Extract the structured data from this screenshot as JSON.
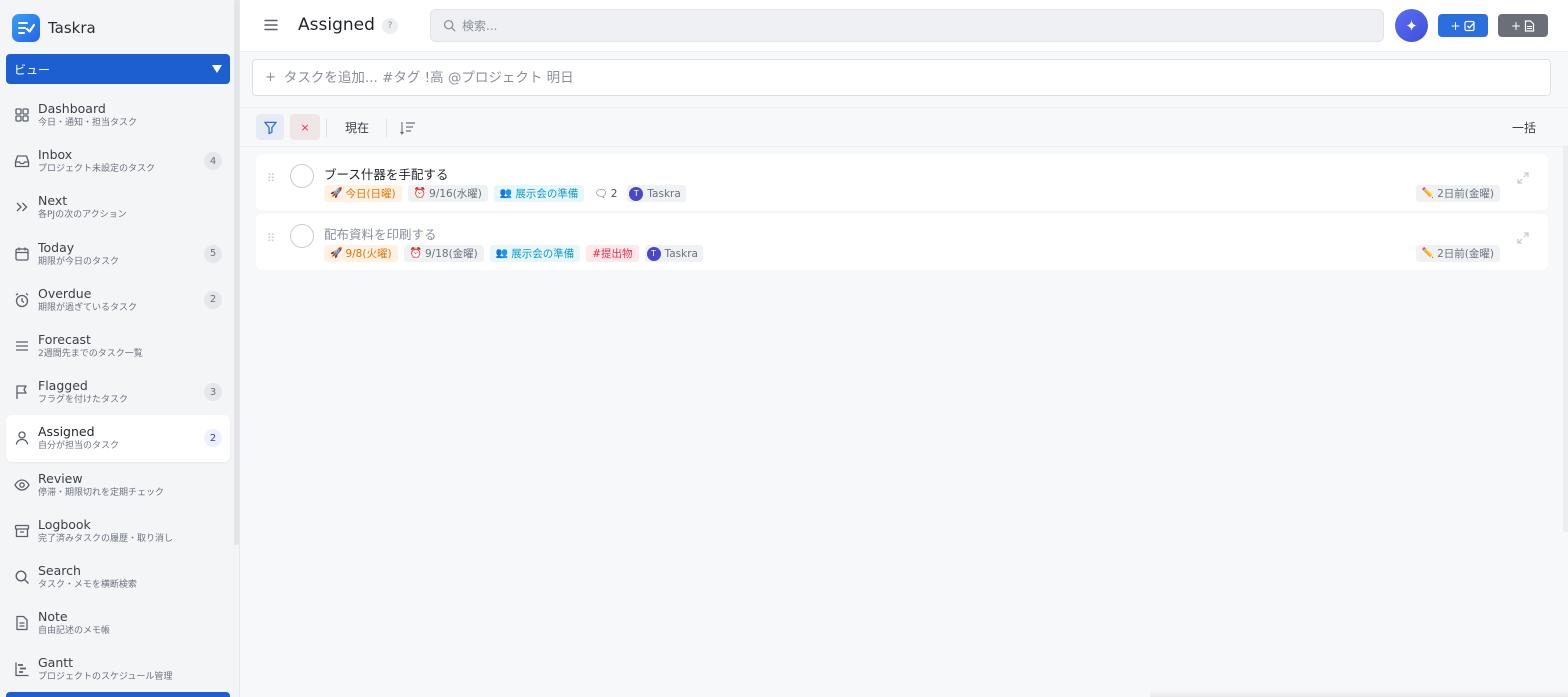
{
  "app": {
    "name": "Taskra"
  },
  "sidebar": {
    "view_select": "ビュー",
    "items": [
      {
        "id": "dashboard",
        "title": "Dashboard",
        "subtitle": "今日・通知・担当タスク",
        "badge": "",
        "icon": "grid-icon"
      },
      {
        "id": "inbox",
        "title": "Inbox",
        "subtitle": "プロジェクト未設定のタスク",
        "badge": "4",
        "icon": "inbox-icon"
      },
      {
        "id": "next",
        "title": "Next",
        "subtitle": "各PJの次のアクション",
        "badge": "",
        "icon": "double-chevron-right-icon"
      },
      {
        "id": "today",
        "title": "Today",
        "subtitle": "期限が今日のタスク",
        "badge": "5",
        "icon": "calendar-icon"
      },
      {
        "id": "overdue",
        "title": "Overdue",
        "subtitle": "期限が過ぎているタスク",
        "badge": "2",
        "icon": "alarm-clock-icon"
      },
      {
        "id": "forecast",
        "title": "Forecast",
        "subtitle": "2週間先までのタスク一覧",
        "badge": "",
        "icon": "lines-icon"
      },
      {
        "id": "flagged",
        "title": "Flagged",
        "subtitle": "フラグを付けたタスク",
        "badge": "3",
        "icon": "flag-icon"
      },
      {
        "id": "assigned",
        "title": "Assigned",
        "subtitle": "自分が担当のタスク",
        "badge": "2",
        "icon": "person-icon",
        "active": true
      },
      {
        "id": "review",
        "title": "Review",
        "subtitle": "停滞・期限切れを定期チェック",
        "badge": "",
        "icon": "eye-icon"
      },
      {
        "id": "logbook",
        "title": "Logbook",
        "subtitle": "完了済みタスクの履歴・取り消し",
        "badge": "",
        "icon": "archive-icon"
      },
      {
        "id": "search",
        "title": "Search",
        "subtitle": "タスク・メモを横断検索",
        "badge": "",
        "icon": "search-icon"
      },
      {
        "id": "note",
        "title": "Note",
        "subtitle": "自由記述のメモ帳",
        "badge": "",
        "icon": "document-icon"
      },
      {
        "id": "gantt",
        "title": "Gantt",
        "subtitle": "プロジェクトのスケジュール管理",
        "badge": "",
        "icon": "gantt-icon"
      }
    ]
  },
  "header": {
    "title": "Assigned",
    "help": "?",
    "search_placeholder": "検索...",
    "add_task_label": "+",
    "add_note_label": "+"
  },
  "quick_add": {
    "placeholder": "タスクを追加... #タグ !高 @プロジェクト 明日"
  },
  "filter_bar": {
    "clear": "×",
    "now": "現在",
    "bulk": "一括"
  },
  "tasks": [
    {
      "title": "ブース什器を手配する",
      "start": "今日(日曜)",
      "due": "9/16(水曜)",
      "project": "展示会の準備",
      "tag": "",
      "comments": "2",
      "assignee_initial": "T",
      "assignee": "Taskra",
      "updated": "2日前(金曜)",
      "muted": false
    },
    {
      "title": "配布資料を印刷する",
      "start": "9/8(火曜)",
      "due": "9/18(金曜)",
      "project": "展示会の準備",
      "tag": "#提出物",
      "comments": "",
      "assignee_initial": "T",
      "assignee": "Taskra",
      "updated": "2日前(金曜)",
      "muted": true
    }
  ],
  "colors": {
    "accent": "#2b6fde",
    "view_select": "#1d5fd1",
    "avatar": "#4a48c8",
    "start_chip": "#d97706",
    "project_chip": "#0e9ac4",
    "tag_chip": "#e0314b"
  }
}
